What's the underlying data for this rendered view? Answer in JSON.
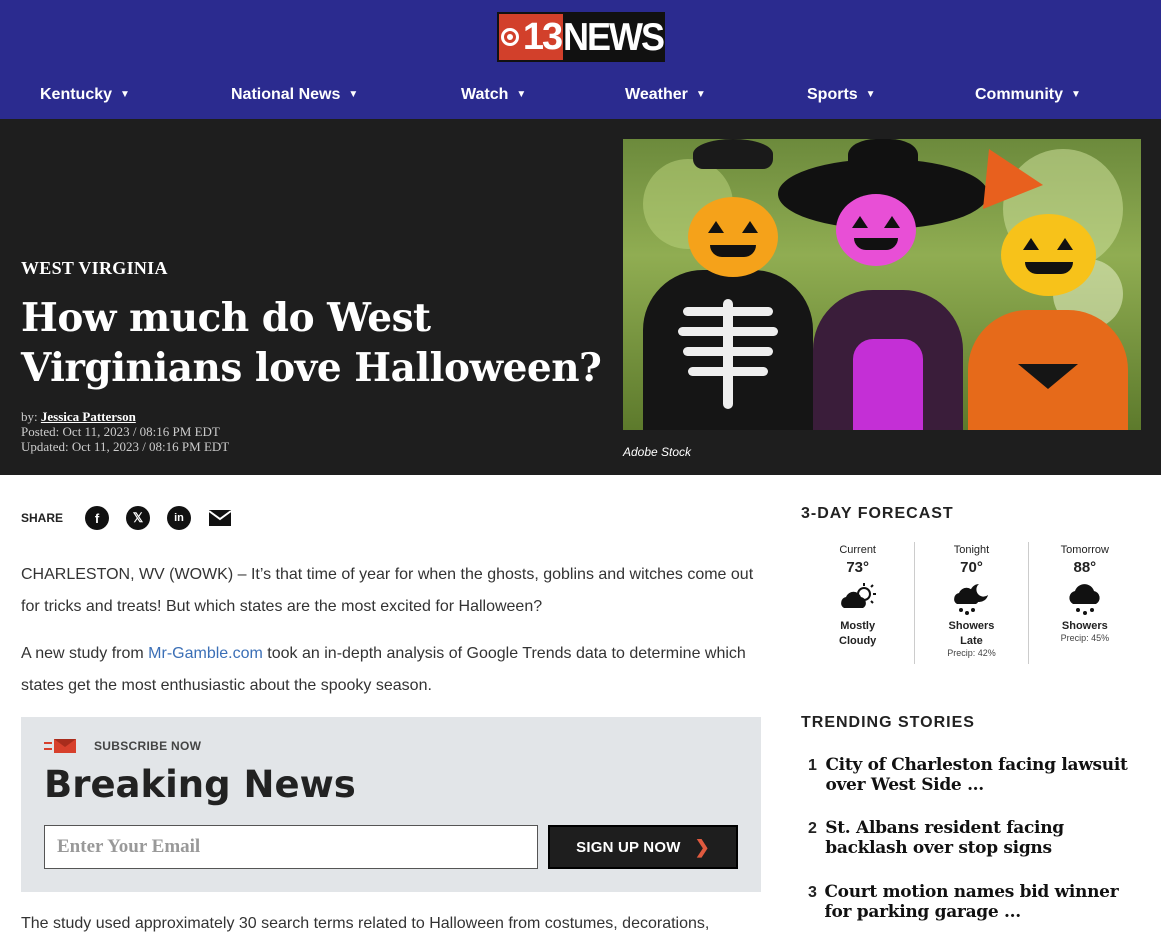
{
  "brand": {
    "logo_number": "13",
    "logo_word": "NEWS",
    "primary_color": "#2b2b8f",
    "accent_color": "#d2402b"
  },
  "nav": {
    "items": [
      {
        "label": "Kentucky"
      },
      {
        "label": "National News"
      },
      {
        "label": "Watch"
      },
      {
        "label": "Weather"
      },
      {
        "label": "Sports"
      },
      {
        "label": "Community"
      }
    ]
  },
  "article": {
    "kicker": "WEST VIRGINIA",
    "headline": "How much do West Virginians love Halloween?",
    "by_prefix": "by:",
    "author": "Jessica Patterson",
    "posted": "Posted: Oct 11, 2023 / 08:16 PM EDT",
    "updated": "Updated: Oct 11, 2023 / 08:16 PM EDT",
    "image_caption": "Adobe Stock",
    "share_label": "SHARE",
    "share_icons": [
      "facebook-icon",
      "x-icon",
      "linkedin-icon",
      "email-icon"
    ],
    "p1": "CHARLESTON, WV (WOWK) – It’s that time of year for when the ghosts, goblins and witches come out for tricks and treats! But which states are the most excited for Halloween?",
    "p2_before": "A new study from ",
    "p2_link": "Mr-Gamble.com",
    "p2_after": " took an in-depth analysis of Google Trends data to determine which states get the most enthusiastic about the spooky season.",
    "p3": "The study used approximately 30 search terms related to Halloween from costumes, decorations,"
  },
  "newsletter": {
    "eyebrow": "SUBSCRIBE NOW",
    "title": "Breaking News",
    "email_placeholder": "Enter Your Email",
    "button_label": "SIGN UP NOW"
  },
  "forecast": {
    "heading": "3-DAY FORECAST",
    "days": [
      {
        "label": "Current",
        "temp": "73°",
        "condition_1": "Mostly",
        "condition_2": "Cloudy",
        "precip": "",
        "icon": "partly-cloudy-icon"
      },
      {
        "label": "Tonight",
        "temp": "70°",
        "condition_1": "Showers",
        "condition_2": "Late",
        "precip": "Precip: 42%",
        "icon": "night-showers-icon"
      },
      {
        "label": "Tomorrow",
        "temp": "88°",
        "condition_1": "Showers",
        "condition_2": "",
        "precip": "Precip: 45%",
        "icon": "showers-icon"
      }
    ]
  },
  "trending": {
    "heading": "TRENDING STORIES",
    "items": [
      {
        "num": "1",
        "title": "City of Charleston facing lawsuit over West Side ..."
      },
      {
        "num": "2",
        "title": "St. Albans resident facing backlash over stop signs"
      },
      {
        "num": "3",
        "title": "Court motion names bid winner for parking garage ..."
      }
    ]
  }
}
